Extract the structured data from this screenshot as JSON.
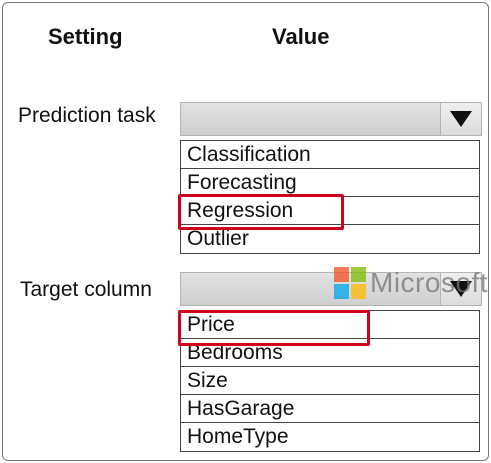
{
  "headers": {
    "setting": "Setting",
    "value": "Value"
  },
  "prediction_task": {
    "label": "Prediction task",
    "selected_value": "",
    "options": [
      "Classification",
      "Forecasting",
      "Regression",
      "Outlier"
    ],
    "highlighted_option": "Regression"
  },
  "target_column": {
    "label": "Target column",
    "selected_value": "",
    "options": [
      "Price",
      "Bedrooms",
      "Size",
      "HasGarage",
      "HomeType"
    ],
    "highlighted_option": "Price"
  },
  "logo": {
    "text": "Microsoft",
    "colors": [
      "#f25022",
      "#7fba00",
      "#00a4ef",
      "#ffb900"
    ]
  },
  "colors": {
    "highlight": "#d0021b",
    "dropdown_bg": "#d9d9d9",
    "border": "#444444"
  }
}
